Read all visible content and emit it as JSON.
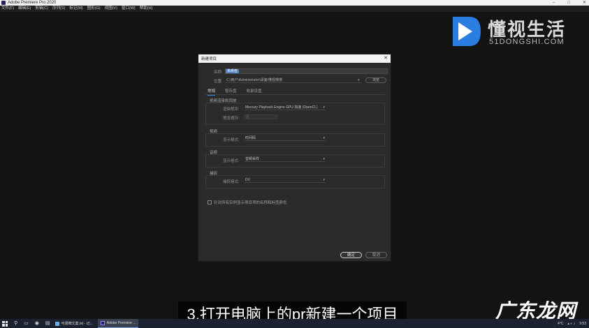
{
  "window": {
    "title": "Adobe Premiere Pro 2020",
    "controls": [
      "–",
      "□",
      "✕"
    ]
  },
  "menu": {
    "items": [
      "文件(F)",
      "编辑(E)",
      "剪辑(C)",
      "序列(S)",
      "标记(M)",
      "图形(G)",
      "视图(V)",
      "窗口(W)",
      "帮助(H)"
    ]
  },
  "watermark": {
    "cn": "懂视生活",
    "en": "51DONGSHI.COM",
    "accent": "#2a7de1"
  },
  "dialog": {
    "title": "新建项目",
    "close": "✕",
    "name_label": "名称:",
    "name_value": "未命名",
    "location_label": "位置:",
    "location_value": "C:\\用户\\Administrator\\桌面\\懂视慢慢",
    "browse_label": "浏览",
    "tabs": [
      {
        "label": "常规",
        "active": true
      },
      {
        "label": "暂存盘",
        "active": false
      },
      {
        "label": "收录设置",
        "active": false
      }
    ],
    "groups": {
      "render": {
        "title": "视频渲染和回放",
        "renderer_label": "渲染程序:",
        "renderer_value": "Mercury Playback Engine GPU 加速 (OpenCL)",
        "preview_label": "预览缓存:",
        "preview_value": "否"
      },
      "video": {
        "title": "视频",
        "format_label": "显示格式:",
        "format_value": "时间码"
      },
      "audio": {
        "title": "音频",
        "format_label": "显示格式:",
        "format_value": "音频采样"
      },
      "capture": {
        "title": "捕捉",
        "format_label": "捕捉格式:",
        "format_value": "DV"
      }
    },
    "checkbox_label": "针对所有实例显示项目项的名称和标签颜色",
    "ok_label": "确定",
    "cancel_label": "取消"
  },
  "subtitle": "3.打开电脑上的pr新建一个项目",
  "corner_watermark": "广东龙网",
  "taskbar": {
    "tasks": [
      {
        "label": "可漫牌文案.txt - 记...",
        "active": false
      },
      {
        "label": "Adobe Premiere ...",
        "active": true
      }
    ],
    "tray": {
      "temp": "4°C",
      "time": "9:53"
    }
  }
}
